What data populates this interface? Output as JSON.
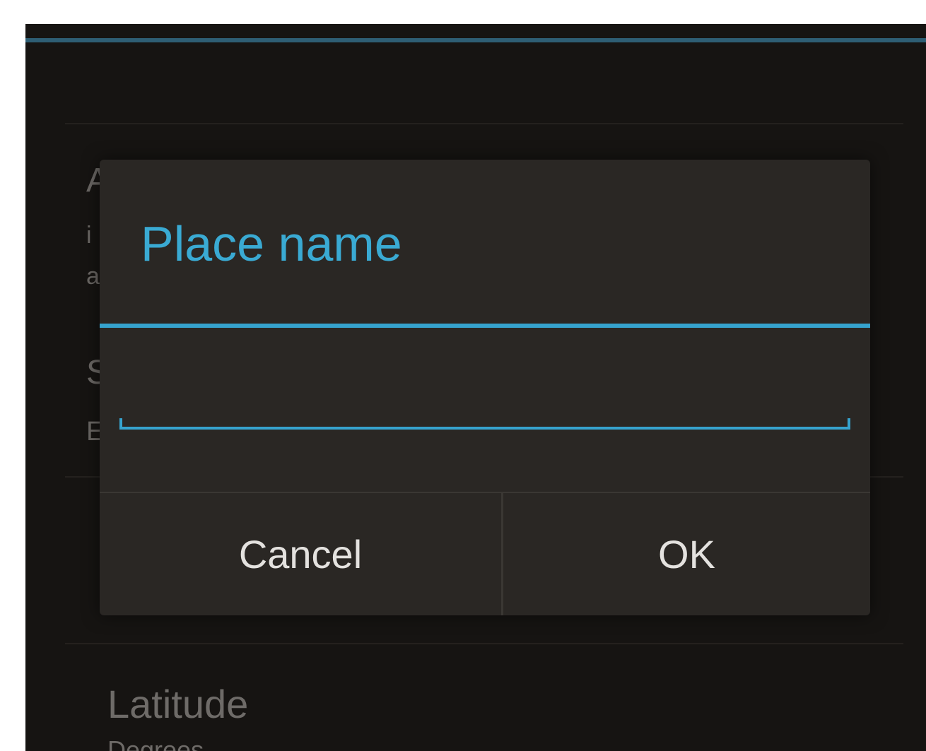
{
  "dialog": {
    "title": "Place name",
    "input_value": "",
    "cancel_label": "Cancel",
    "ok_label": "OK"
  },
  "background": {
    "fragments": [
      "A",
      "i",
      "a",
      "S",
      "E"
    ],
    "latitude_title": "Latitude",
    "latitude_summary": "Degrees"
  },
  "colors": {
    "accent": "#36a3ce",
    "dialog_bg": "#2a2724",
    "screen_bg": "#161412"
  }
}
